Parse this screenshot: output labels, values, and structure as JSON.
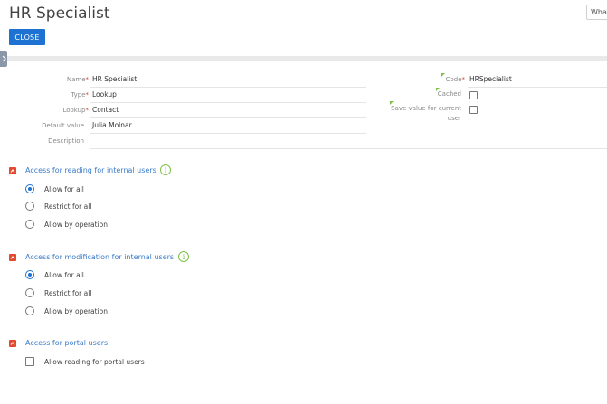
{
  "header": {
    "title": "HR Specialist",
    "whats_new_label": "What's new",
    "close_label": "CLOSE"
  },
  "form": {
    "name": {
      "label": "Name",
      "value": "HR Specialist",
      "required": true
    },
    "type": {
      "label": "Type",
      "value": "Lookup",
      "required": true
    },
    "lookup": {
      "label": "Lookup",
      "value": "Contact",
      "required": true
    },
    "default_value": {
      "label": "Default value",
      "value": "Julia Molnar"
    },
    "description": {
      "label": "Description",
      "value": ""
    },
    "code": {
      "label": "Code",
      "value": "HRSpecialist",
      "required": true
    },
    "cached": {
      "label": "Cached",
      "checked": false
    },
    "save_value": {
      "label_line1": "Save value for current",
      "label_line2": "user",
      "checked": false
    }
  },
  "sections": {
    "read_access": {
      "title": "Access for reading for internal users",
      "options": [
        "Allow for all",
        "Restrict for all",
        "Allow by operation"
      ],
      "selected": "Allow for all"
    },
    "modify_access": {
      "title": "Access for modification for internal users",
      "options": [
        "Allow for all",
        "Restrict for all",
        "Allow by operation"
      ],
      "selected": "Allow for all"
    },
    "portal_access": {
      "title": "Access for portal users",
      "option": "Allow reading for portal users",
      "checked": false
    }
  },
  "icons": [
    "chevron-right-icon",
    "collapse-icon",
    "info-icon",
    "required-marker"
  ],
  "colors": {
    "primary_button": "#1e73d2",
    "section_title": "#3a7bc8",
    "section_toggle": "#e2492f",
    "info_icon": "#7ec247",
    "required": "#e03c31"
  }
}
